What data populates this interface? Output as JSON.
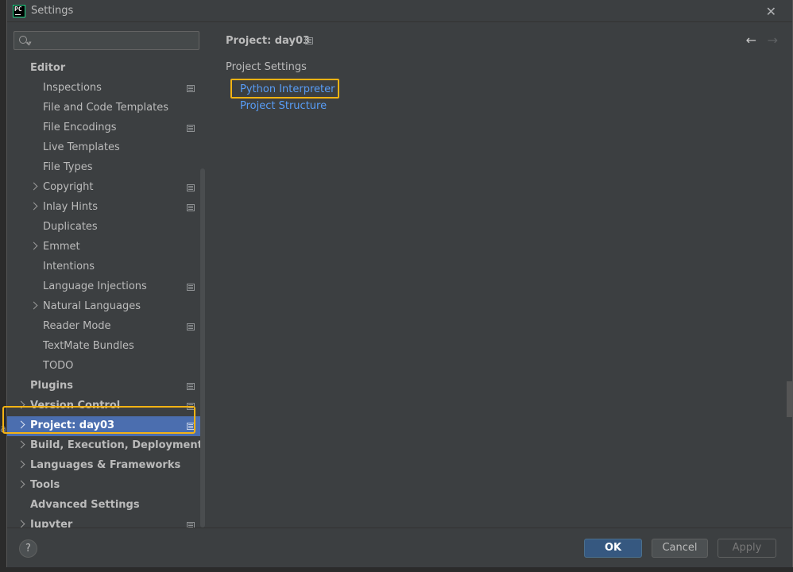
{
  "window": {
    "title": "Settings",
    "app_logo_text": "PC",
    "close_icon": "close-icon"
  },
  "search": {
    "value": "",
    "placeholder": ""
  },
  "tree": {
    "editor_group": "Editor",
    "items": [
      {
        "label": "Inspections",
        "indent": 2,
        "bold": false,
        "chevron": false,
        "project_icon": true
      },
      {
        "label": "File and Code Templates",
        "indent": 2,
        "bold": false,
        "chevron": false,
        "project_icon": false
      },
      {
        "label": "File Encodings",
        "indent": 2,
        "bold": false,
        "chevron": false,
        "project_icon": true
      },
      {
        "label": "Live Templates",
        "indent": 2,
        "bold": false,
        "chevron": false,
        "project_icon": false
      },
      {
        "label": "File Types",
        "indent": 2,
        "bold": false,
        "chevron": false,
        "project_icon": false
      },
      {
        "label": "Copyright",
        "indent": 2,
        "bold": false,
        "chevron": true,
        "project_icon": true
      },
      {
        "label": "Inlay Hints",
        "indent": 2,
        "bold": false,
        "chevron": true,
        "project_icon": true
      },
      {
        "label": "Duplicates",
        "indent": 2,
        "bold": false,
        "chevron": false,
        "project_icon": false
      },
      {
        "label": "Emmet",
        "indent": 2,
        "bold": false,
        "chevron": true,
        "project_icon": false
      },
      {
        "label": "Intentions",
        "indent": 2,
        "bold": false,
        "chevron": false,
        "project_icon": false
      },
      {
        "label": "Language Injections",
        "indent": 2,
        "bold": false,
        "chevron": false,
        "project_icon": true
      },
      {
        "label": "Natural Languages",
        "indent": 2,
        "bold": false,
        "chevron": true,
        "project_icon": false
      },
      {
        "label": "Reader Mode",
        "indent": 2,
        "bold": false,
        "chevron": false,
        "project_icon": true
      },
      {
        "label": "TextMate Bundles",
        "indent": 2,
        "bold": false,
        "chevron": false,
        "project_icon": false
      },
      {
        "label": "TODO",
        "indent": 2,
        "bold": false,
        "chevron": false,
        "project_icon": false
      },
      {
        "label": "Plugins",
        "indent": 1,
        "bold": true,
        "chevron": false,
        "project_icon": true
      },
      {
        "label": "Version Control",
        "indent": 1,
        "bold": true,
        "chevron": true,
        "project_icon": true
      },
      {
        "label": "Project: day03",
        "indent": 1,
        "bold": true,
        "chevron": true,
        "project_icon": true,
        "selected": true
      },
      {
        "label": "Build, Execution, Deployment",
        "indent": 1,
        "bold": true,
        "chevron": true,
        "project_icon": false
      },
      {
        "label": "Languages & Frameworks",
        "indent": 1,
        "bold": true,
        "chevron": true,
        "project_icon": false
      },
      {
        "label": "Tools",
        "indent": 1,
        "bold": true,
        "chevron": true,
        "project_icon": false
      },
      {
        "label": "Advanced Settings",
        "indent": 1,
        "bold": true,
        "chevron": false,
        "project_icon": false
      },
      {
        "label": "Jupyter",
        "indent": 1,
        "bold": true,
        "chevron": true,
        "project_icon": true
      }
    ]
  },
  "content": {
    "breadcrumb": "Project: day03",
    "section_title": "Project Settings",
    "links": {
      "python_interpreter": "Python Interpreter",
      "project_structure": "Project Structure"
    },
    "nav_back": "←",
    "nav_forward": "→"
  },
  "footer": {
    "help": "?",
    "ok": "OK",
    "cancel": "Cancel",
    "apply": "Apply"
  },
  "colors": {
    "background": "#3c3f41",
    "selection": "#4b6eaf",
    "link": "#589df6",
    "highlight_box": "#f5b313",
    "ok_button": "#365880"
  }
}
